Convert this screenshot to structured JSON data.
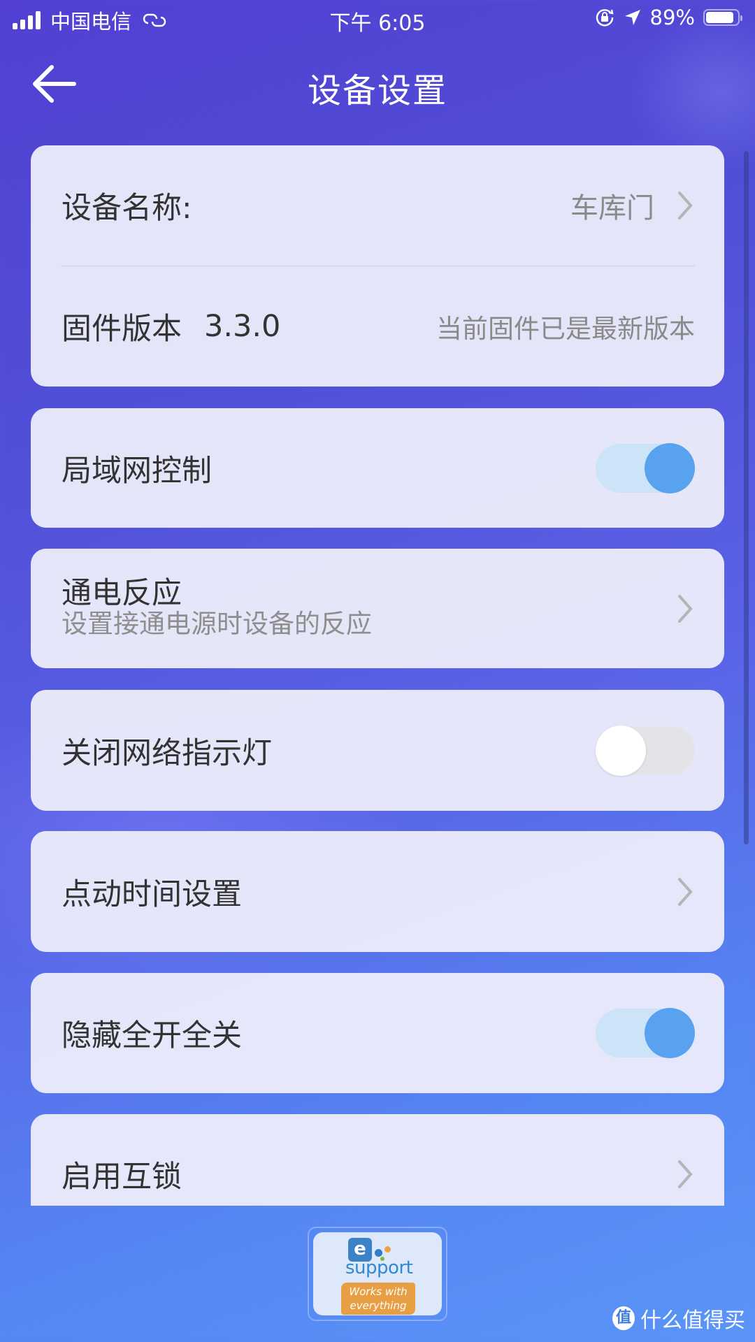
{
  "status_bar": {
    "carrier": "中国电信",
    "time": "下午 6:05",
    "battery_percent": "89%",
    "battery_level": 0.89,
    "icons": [
      "signal-icon",
      "hotspot-link-icon",
      "rotation-lock-icon",
      "location-icon",
      "battery-icon"
    ]
  },
  "header": {
    "back_icon": "arrow-left-icon",
    "title": "设备设置"
  },
  "settings": {
    "device_name": {
      "label": "设备名称:",
      "value": "车库门"
    },
    "firmware": {
      "label": "固件版本",
      "version": "3.3.0",
      "status": "当前固件已是最新版本"
    },
    "lan_control": {
      "label": "局域网控制",
      "enabled": true
    },
    "power_on_state": {
      "label": "通电反应",
      "description": "设置接通电源时设备的反应"
    },
    "disable_network_led": {
      "label": "关闭网络指示灯",
      "enabled": false
    },
    "inching_settings": {
      "label": "点动时间设置"
    },
    "hide_all_on_off": {
      "label": "隐藏全开全关",
      "enabled": true
    },
    "interlock": {
      "label": "启用互锁"
    }
  },
  "logo": {
    "letter": "e",
    "name": "support",
    "tagline_line1": "Works with",
    "tagline_line2": "everything"
  },
  "watermark": {
    "icon_char": "值",
    "text": "什么值得买"
  },
  "colors": {
    "toggle_on_knob": "#58a2ef",
    "toggle_on_track": "#cde3f8",
    "toggle_off_track": "#e3e3e8",
    "background_start": "#5140d2",
    "background_end": "#5a95f7"
  }
}
